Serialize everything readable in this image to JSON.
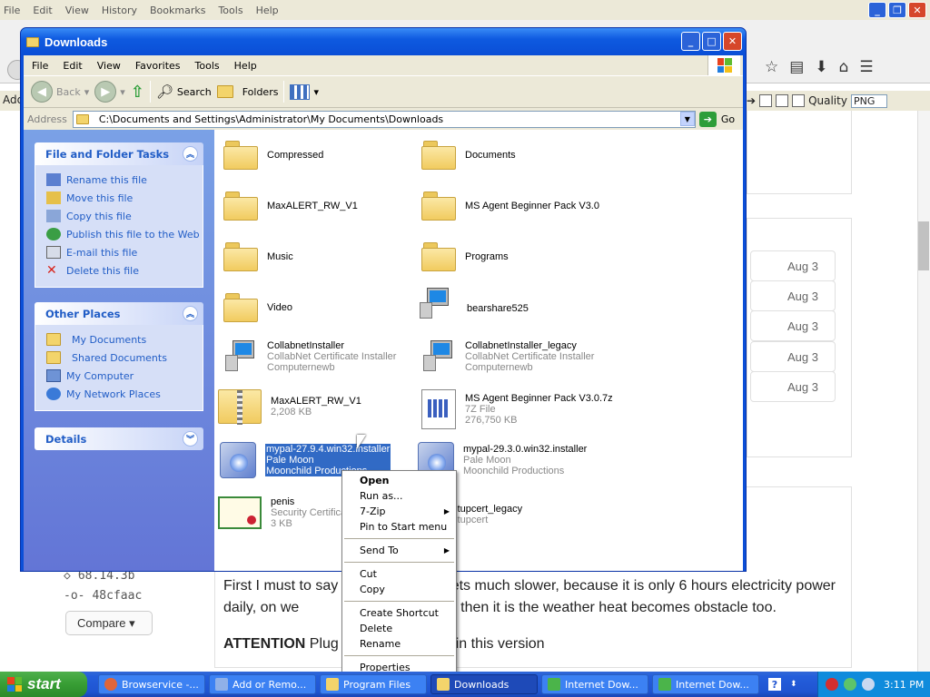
{
  "browser": {
    "menu": [
      "File",
      "Edit",
      "View",
      "History",
      "Bookmarks",
      "Tools",
      "Help"
    ],
    "addon_left": "Add",
    "quality_label": "Quality",
    "format_value": "PNG"
  },
  "page": {
    "dates": [
      "Aug 3",
      "Aug 3",
      "Aug 3",
      "Aug 3",
      "Aug 3"
    ],
    "commits": [
      "68.14.3b",
      "48cfaac"
    ],
    "compare_label": "Compare",
    "article_p1": "First I must to say t                          ets much slower, because it is only 6 hours electricity power daily, on we                           though, then it is the weather heat becomes obstacle too.",
    "article_p2_bold": "ATTENTION",
    "article_p2_rest": " Plug                          n in this version"
  },
  "explorer": {
    "title": "Downloads",
    "menu": [
      "File",
      "Edit",
      "View",
      "Favorites",
      "Tools",
      "Help"
    ],
    "toolbar": {
      "back": "Back",
      "search": "Search",
      "folders": "Folders"
    },
    "address_label": "Address",
    "address_value": "C:\\Documents and Settings\\Administrator\\My Documents\\Downloads",
    "go_label": "Go",
    "panels": {
      "tasks_title": "File and Folder Tasks",
      "tasks": [
        "Rename this file",
        "Move this file",
        "Copy this file",
        "Publish this file to the Web",
        "E-mail this file",
        "Delete this file"
      ],
      "places_title": "Other Places",
      "places": [
        "My Documents",
        "Shared Documents",
        "My Computer",
        "My Network Places"
      ],
      "details_title": "Details"
    },
    "items": {
      "compressed": "Compressed",
      "documents": "Documents",
      "maxalert_folder": "MaxALERT_RW_V1",
      "msagent_folder": "MS Agent Beginner Pack V3.0",
      "music": "Music",
      "programs": "Programs",
      "video": "Video",
      "bearshare": "bearshare525",
      "collabnet": [
        "CollabnetInstaller",
        "CollabNet Certificate Installer",
        "Computernewb"
      ],
      "collabnet_legacy": [
        "CollabnetInstaller_legacy",
        "CollabNet Certificate Installer",
        "Computernewb"
      ],
      "maxalert_zip": [
        "MaxALERT_RW_V1",
        "2,208 KB"
      ],
      "msagent_7z": [
        "MS Agent Beginner Pack V3.0.7z",
        "7Z File",
        "276,750 KB"
      ],
      "mypal27": [
        "mypal-27.9.4.win32.installer",
        "Pale Moon",
        "Moonchild Productions"
      ],
      "mypal29": [
        "mypal-29.3.0.win32.installer",
        "Pale Moon",
        "Moonchild Productions"
      ],
      "penis": [
        "penis",
        "Security Certificate",
        "3 KB"
      ],
      "setupcert": [
        "setupcert_legacy",
        "setupcert"
      ]
    }
  },
  "context_menu": {
    "open": "Open",
    "run_as": "Run as...",
    "zip": "7-Zip",
    "pin": "Pin to Start menu",
    "send_to": "Send To",
    "cut": "Cut",
    "copy": "Copy",
    "create_shortcut": "Create Shortcut",
    "delete": "Delete",
    "rename": "Rename",
    "properties": "Properties"
  },
  "taskbar": {
    "start": "start",
    "buttons": [
      "Browservice -...",
      "Add or Remo...",
      "Program Files",
      "Downloads",
      "Internet Dow...",
      "Internet Dow..."
    ],
    "clock": "3:11 PM"
  }
}
